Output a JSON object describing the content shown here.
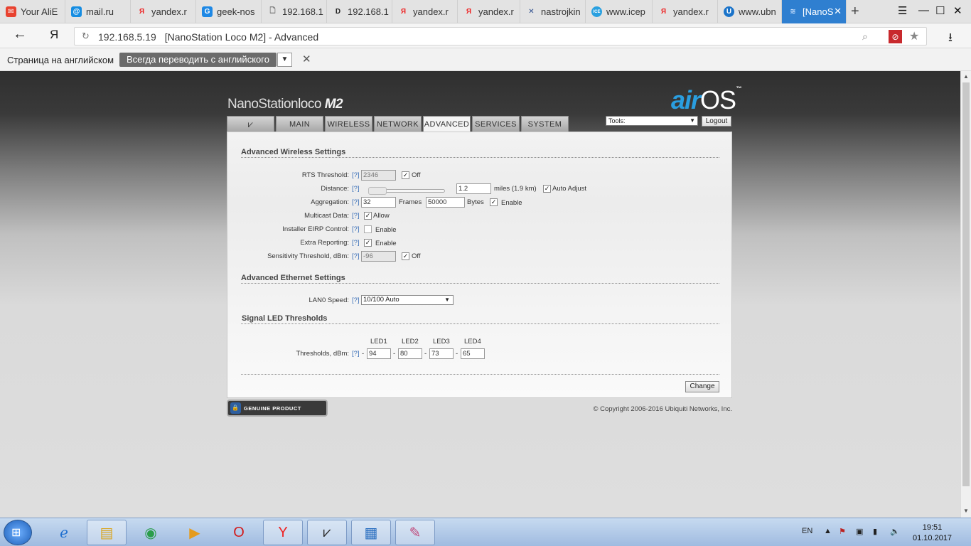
{
  "browser": {
    "tabs": [
      {
        "label": "Your AliE",
        "fav": "aliexpress-icon",
        "color": "#e8422f"
      },
      {
        "label": "mail.ru",
        "fav": "mailru-icon",
        "color": "#168de2"
      },
      {
        "label": "yandex.r",
        "fav": "yandex-icon",
        "color": "#e22"
      },
      {
        "label": "geek-nos",
        "fav": "geek-icon",
        "color": "#1e88e5"
      },
      {
        "label": "192.168.1",
        "fav": "page-icon",
        "color": "#888"
      },
      {
        "label": "192.168.1",
        "fav": "d-icon",
        "color": "#333"
      },
      {
        "label": "yandex.r",
        "fav": "yandex-icon",
        "color": "#e22"
      },
      {
        "label": "yandex.r",
        "fav": "yandex-icon",
        "color": "#e22"
      },
      {
        "label": "nastrojkin",
        "fav": "tools-icon",
        "color": "#2b4c8c"
      },
      {
        "label": "www.icep",
        "fav": "ice-icon",
        "color": "#29a0e0"
      },
      {
        "label": "yandex.r",
        "fav": "yandex-icon",
        "color": "#e22"
      },
      {
        "label": "www.ubn",
        "fav": "ubnt-icon",
        "color": "#1a73c9"
      },
      {
        "label": "[NanoS",
        "fav": "wifi-icon",
        "color": "#2f7fd0"
      }
    ],
    "address": {
      "host": "192.168.5.19",
      "title": "[NanoStation Loco M2] - Advanced"
    },
    "translate": {
      "label": "Страница на английском",
      "button": "Всегда переводить с английского"
    }
  },
  "airos": {
    "product": {
      "part1": "NanoStation",
      "part2": "loco",
      "part3": "M2"
    },
    "brand": {
      "air": "air",
      "os": "OS",
      "tm": "™"
    },
    "nav": [
      {
        "label": ""
      },
      {
        "label": "MAIN"
      },
      {
        "label": "WIRELESS"
      },
      {
        "label": "NETWORK"
      },
      {
        "label": "ADVANCED"
      },
      {
        "label": "SERVICES"
      },
      {
        "label": "SYSTEM"
      }
    ],
    "tools": {
      "value": "Tools:"
    },
    "logout": "Logout",
    "help": "[?]",
    "wireless": {
      "title": "Advanced Wireless Settings",
      "rts": {
        "label": "RTS Threshold:",
        "value": "2346",
        "off": "Off"
      },
      "distance": {
        "label": "Distance:",
        "value": "1.2",
        "units": "miles (1.9 km)",
        "auto": "Auto Adjust"
      },
      "aggregation": {
        "label": "Aggregation:",
        "frames_value": "32",
        "frames_label": "Frames",
        "bytes_value": "50000",
        "bytes_label": "Bytes",
        "enable": "Enable"
      },
      "multicast": {
        "label": "Multicast Data:",
        "allow": "Allow"
      },
      "eirp": {
        "label": "Installer EIRP Control:",
        "enable": "Enable"
      },
      "extra": {
        "label": "Extra Reporting:",
        "enable": "Enable"
      },
      "sensitivity": {
        "label": "Sensitivity Threshold, dBm:",
        "value": "-96",
        "off": "Off"
      }
    },
    "ethernet": {
      "title": "Advanced Ethernet Settings",
      "lan0": {
        "label": "LAN0 Speed:",
        "value": "10/100 Auto"
      }
    },
    "led": {
      "title": "Signal LED Thresholds",
      "headers": [
        "LED1",
        "LED2",
        "LED3",
        "LED4"
      ],
      "label": "Thresholds, dBm:",
      "values": [
        "94",
        "80",
        "73",
        "65"
      ],
      "dash": "-"
    },
    "change": "Change",
    "genuine": "GENUINE PRODUCT",
    "copyright": "© Copyright 2006-2016 Ubiquiti Networks, Inc."
  },
  "taskbar": {
    "lang": "EN",
    "time": "19:51",
    "date": "01.10.2017"
  }
}
